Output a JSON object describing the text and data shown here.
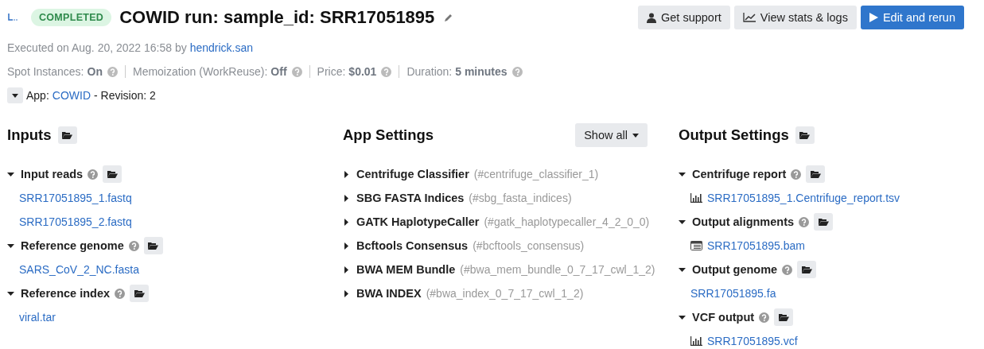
{
  "header": {
    "status": "COMPLETED",
    "title": "COWID run: sample_id: SRR17051895",
    "buttons": [
      {
        "label": "Get support",
        "kind": "support"
      },
      {
        "label": "View stats & logs",
        "kind": "stats"
      },
      {
        "label": "Edit and rerun",
        "kind": "primary"
      }
    ]
  },
  "executed": {
    "text": "Executed on Aug. 20, 2022 16:58 by",
    "user": "hendrick.san"
  },
  "meta": [
    {
      "label": "Spot Instances:",
      "value": "On"
    },
    {
      "label": "Memoization (WorkReuse):",
      "value": "Off"
    },
    {
      "label": "Price:",
      "value": "$0.01"
    },
    {
      "label": "Duration:",
      "value": "5 minutes"
    }
  ],
  "app": {
    "expanded": false,
    "label": "App:",
    "name": "COWID",
    "revision": "- Revision: 2"
  },
  "inputs": {
    "title": "Inputs",
    "groups": [
      {
        "label": "Input reads",
        "expanded": true,
        "files": [
          {
            "name": "SRR17051895_1.fastq"
          },
          {
            "name": "SRR17051895_2.fastq"
          }
        ]
      },
      {
        "label": "Reference genome",
        "expanded": true,
        "files": [
          {
            "name": "SARS_CoV_2_NC.fasta"
          }
        ]
      },
      {
        "label": "Reference index",
        "expanded": true,
        "files": [
          {
            "name": "viral.tar"
          }
        ]
      }
    ]
  },
  "app_settings": {
    "title": "App Settings",
    "button": "Show all",
    "items": [
      {
        "name": "Centrifuge Classifier",
        "id": "(#centrifuge_classifier_1)",
        "expanded": false
      },
      {
        "name": "SBG FASTA Indices",
        "id": "(#sbg_fasta_indices)",
        "expanded": false
      },
      {
        "name": "GATK HaplotypeCaller",
        "id": "(#gatk_haplotypecaller_4_2_0_0)",
        "expanded": false
      },
      {
        "name": "Bcftools Consensus",
        "id": "(#bcftools_consensus)",
        "expanded": false
      },
      {
        "name": "BWA MEM Bundle",
        "id": "(#bwa_mem_bundle_0_7_17_cwl_1_2)",
        "expanded": false
      },
      {
        "name": "BWA INDEX",
        "id": "(#bwa_index_0_7_17_cwl_1_2)",
        "expanded": false
      }
    ]
  },
  "outputs": {
    "title": "Output Settings",
    "groups": [
      {
        "label": "Centrifuge report",
        "expanded": true,
        "files": [
          {
            "name": "SRR17051895_1.Centrifuge_report.tsv",
            "kind": "chart"
          }
        ]
      },
      {
        "label": "Output alignments",
        "expanded": true,
        "files": [
          {
            "name": "SRR17051895.bam",
            "kind": "table"
          }
        ]
      },
      {
        "label": "Output genome",
        "expanded": true,
        "files": [
          {
            "name": "SRR17051895.fa",
            "kind": "plain"
          }
        ]
      },
      {
        "label": "VCF output",
        "expanded": true,
        "files": [
          {
            "name": "SRR17051895.vcf",
            "kind": "chart"
          }
        ]
      }
    ]
  }
}
